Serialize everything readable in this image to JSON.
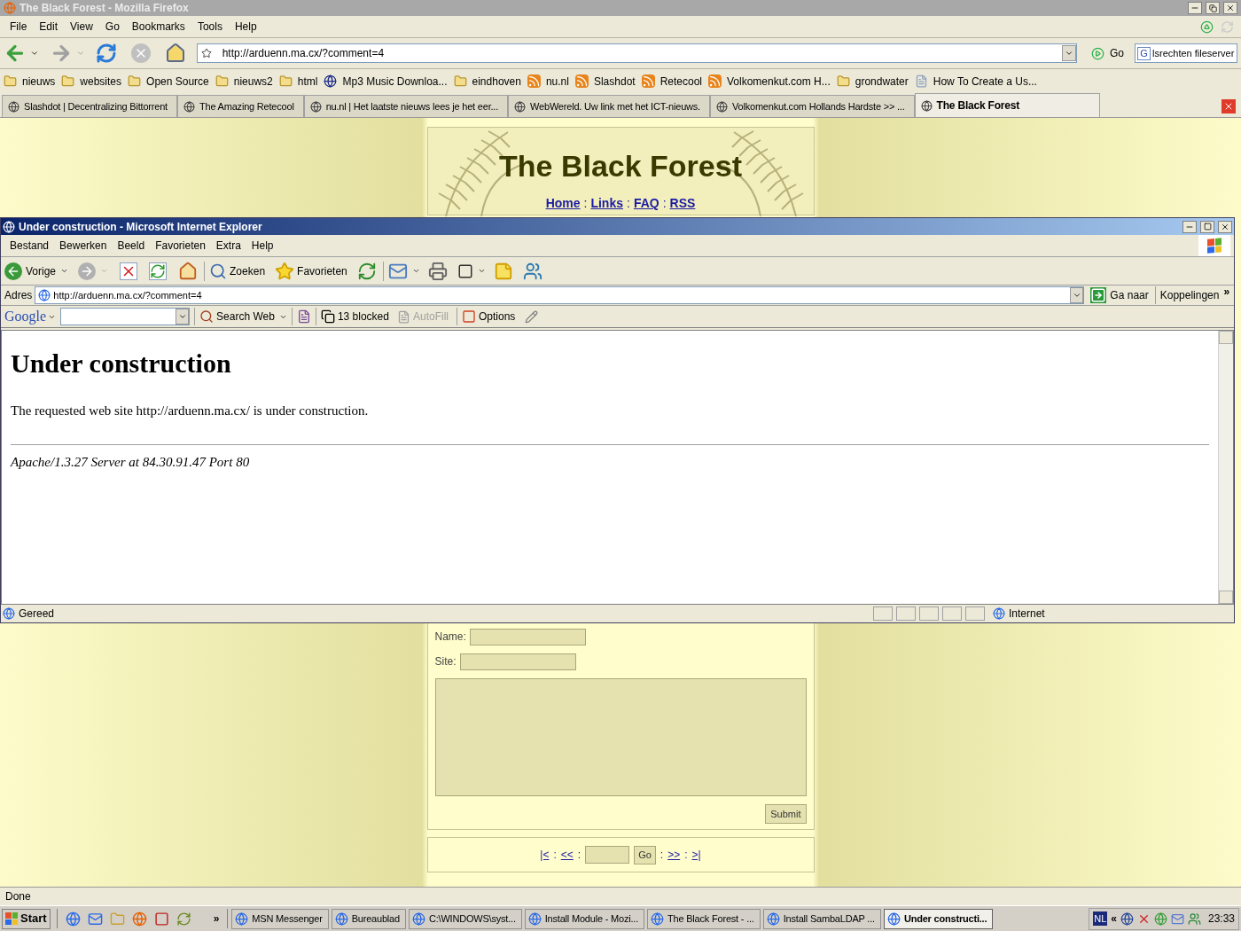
{
  "firefox": {
    "title": "The Black Forest - Mozilla Firefox",
    "menu": [
      "File",
      "Edit",
      "View",
      "Go",
      "Bookmarks",
      "Tools",
      "Help"
    ],
    "address": "http://arduenn.ma.cx/?comment=4",
    "go": "Go",
    "search_engine": "G",
    "search": "lsrechten fileserver",
    "bookmarks": [
      {
        "label": "nieuws",
        "kind": "folder"
      },
      {
        "label": "websites",
        "kind": "folder"
      },
      {
        "label": "Open Source",
        "kind": "folder"
      },
      {
        "label": "nieuws2",
        "kind": "folder"
      },
      {
        "label": "html",
        "kind": "folder"
      },
      {
        "label": "Mp3 Music Downloa...",
        "kind": "site"
      },
      {
        "label": "eindhoven",
        "kind": "folder"
      },
      {
        "label": "nu.nl",
        "kind": "feed"
      },
      {
        "label": "Slashdot",
        "kind": "feed"
      },
      {
        "label": "Retecool",
        "kind": "feed"
      },
      {
        "label": "Volkomenkut.com H...",
        "kind": "feed"
      },
      {
        "label": "grondwater",
        "kind": "folder"
      },
      {
        "label": "How To Create a Us...",
        "kind": "page"
      }
    ],
    "tabs": [
      {
        "label": "Slashdot | Decentralizing Bittorrent",
        "selected": false
      },
      {
        "label": "The Amazing Retecool",
        "selected": false
      },
      {
        "label": "nu.nl | Het laatste nieuws lees je het eer...",
        "selected": false
      },
      {
        "label": "WebWereld. Uw link met het ICT-nieuws.",
        "selected": false
      },
      {
        "label": "Volkomenkut.com Hollands Hardste >> ...",
        "selected": false
      },
      {
        "label": "The Black Forest",
        "selected": true
      }
    ],
    "status": "Done"
  },
  "page": {
    "title": "The Black Forest",
    "nav": [
      {
        "label": "Home",
        "kind": "link"
      },
      {
        "label": ":",
        "kind": "sep"
      },
      {
        "label": "Links",
        "kind": "link"
      },
      {
        "label": ":",
        "kind": "sep"
      },
      {
        "label": "FAQ",
        "kind": "link"
      },
      {
        "label": ":",
        "kind": "sep"
      },
      {
        "label": "RSS",
        "kind": "link"
      }
    ],
    "form": {
      "name_label": "Name:",
      "site_label": "Site:",
      "submit": "Submit"
    },
    "pager": [
      {
        "label": "|<",
        "kind": "link"
      },
      {
        "label": ":",
        "kind": "sep"
      },
      {
        "label": "<<",
        "kind": "link"
      },
      {
        "label": ":",
        "kind": "sep"
      },
      {
        "kind": "input"
      },
      {
        "label": "Go",
        "kind": "button"
      },
      {
        "label": ":",
        "kind": "sep"
      },
      {
        "label": ">>",
        "kind": "link"
      },
      {
        "label": ":",
        "kind": "sep"
      },
      {
        "label": ">|",
        "kind": "link"
      }
    ]
  },
  "ie": {
    "title": "Under construction - Microsoft Internet Explorer",
    "menu": [
      "Bestand",
      "Bewerken",
      "Beeld",
      "Favorieten",
      "Extra",
      "Help"
    ],
    "back": "Vorige",
    "search": "Zoeken",
    "favorites": "Favorieten",
    "address_label": "Adres",
    "address": "http://arduenn.ma.cx/?comment=4",
    "go": "Ga naar",
    "links": "Koppelingen",
    "links_more": "»",
    "google": {
      "logo": "Google",
      "search": "Search Web",
      "blocked": "13 blocked",
      "autofill": "AutoFill",
      "autofill_disabled": true,
      "options": "Options"
    },
    "heading": "Under construction",
    "text": "The requested web site http://arduenn.ma.cx/ is under construction.",
    "footer": "Apache/1.3.27 Server at 84.30.91.47 Port 80",
    "status": "Gereed",
    "zone": "Internet"
  },
  "taskbar": {
    "start": "Start",
    "more": "»",
    "items": [
      {
        "label": "MSN Messenger",
        "selected": false
      },
      {
        "label": "Bureaublad",
        "selected": false
      },
      {
        "label": "C:\\WINDOWS\\syst...",
        "selected": false
      },
      {
        "label": "Install Module - Mozi...",
        "selected": false
      },
      {
        "label": "The Black Forest - ...",
        "selected": false
      },
      {
        "label": "Install SambaLDAP ...",
        "selected": false
      },
      {
        "label": "Under constructi...",
        "selected": true
      }
    ],
    "lang": "NL",
    "tray_more": "«",
    "clock": "23:33"
  }
}
